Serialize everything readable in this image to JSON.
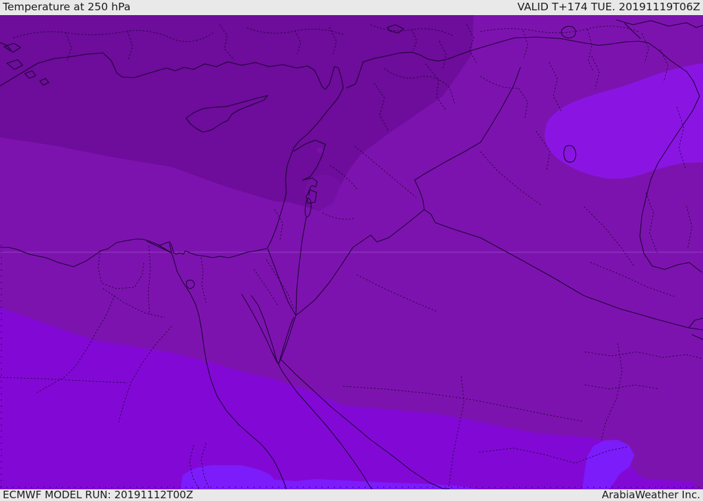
{
  "header": {
    "title": "Temperature at 250 hPa",
    "valid": "VALID T+174 TUE. 20191119T06Z"
  },
  "footer": {
    "model_run": "ECMWF MODEL RUN: 20191112T00Z",
    "credit": "ArabiaWeather Inc."
  },
  "map": {
    "parameter": "Temperature",
    "pressure_level": "250 hPa",
    "colors": {
      "band_dark": "#6E0C9B",
      "band_medium": "#7D13AF",
      "band_bright": "#8209D5",
      "band_brightest": "#7C1CFB",
      "pocket": "#8A15E3",
      "border": "#1C0433",
      "graticule": "#C9A6E0",
      "bar_background": "#E9E9E9",
      "bar_text": "#1A1A1A"
    }
  }
}
